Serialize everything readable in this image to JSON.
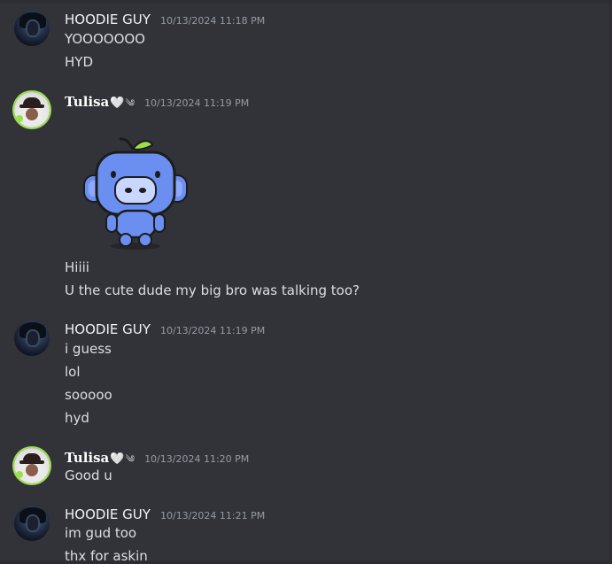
{
  "messages": [
    {
      "author": "HOODIE GUY",
      "timestamp": "10/13/2024 11:18 PM",
      "lines": [
        "YOOOOOOO",
        "HYD"
      ]
    },
    {
      "author": "Tulisa",
      "author_heart": "🤍",
      "author_swirl": "༄",
      "timestamp": "10/13/2024 11:19 PM",
      "sticker": "blue-mascot-sticker",
      "lines": [
        "Hiiii",
        "U the cute dude my big bro was talking too?"
      ]
    },
    {
      "author": "HOODIE GUY",
      "timestamp": "10/13/2024 11:19 PM",
      "lines": [
        "i guess",
        "lol",
        "sooooo",
        "hyd"
      ]
    },
    {
      "author": "Tulisa",
      "author_heart": "🤍",
      "author_swirl": "༄",
      "timestamp": "10/13/2024 11:20 PM",
      "lines": [
        "Good u"
      ]
    },
    {
      "author": "HOODIE GUY",
      "timestamp": "10/13/2024 11:21 PM",
      "lines": [
        "im gud too",
        "thx for askin"
      ]
    }
  ],
  "colors": {
    "background": "#323339",
    "text": "#dbdee1",
    "timestamp": "#949ba4",
    "username": "#f2f3f5",
    "avatar_ring": "#9be04a",
    "sticker_body": "#6b8ff0"
  }
}
